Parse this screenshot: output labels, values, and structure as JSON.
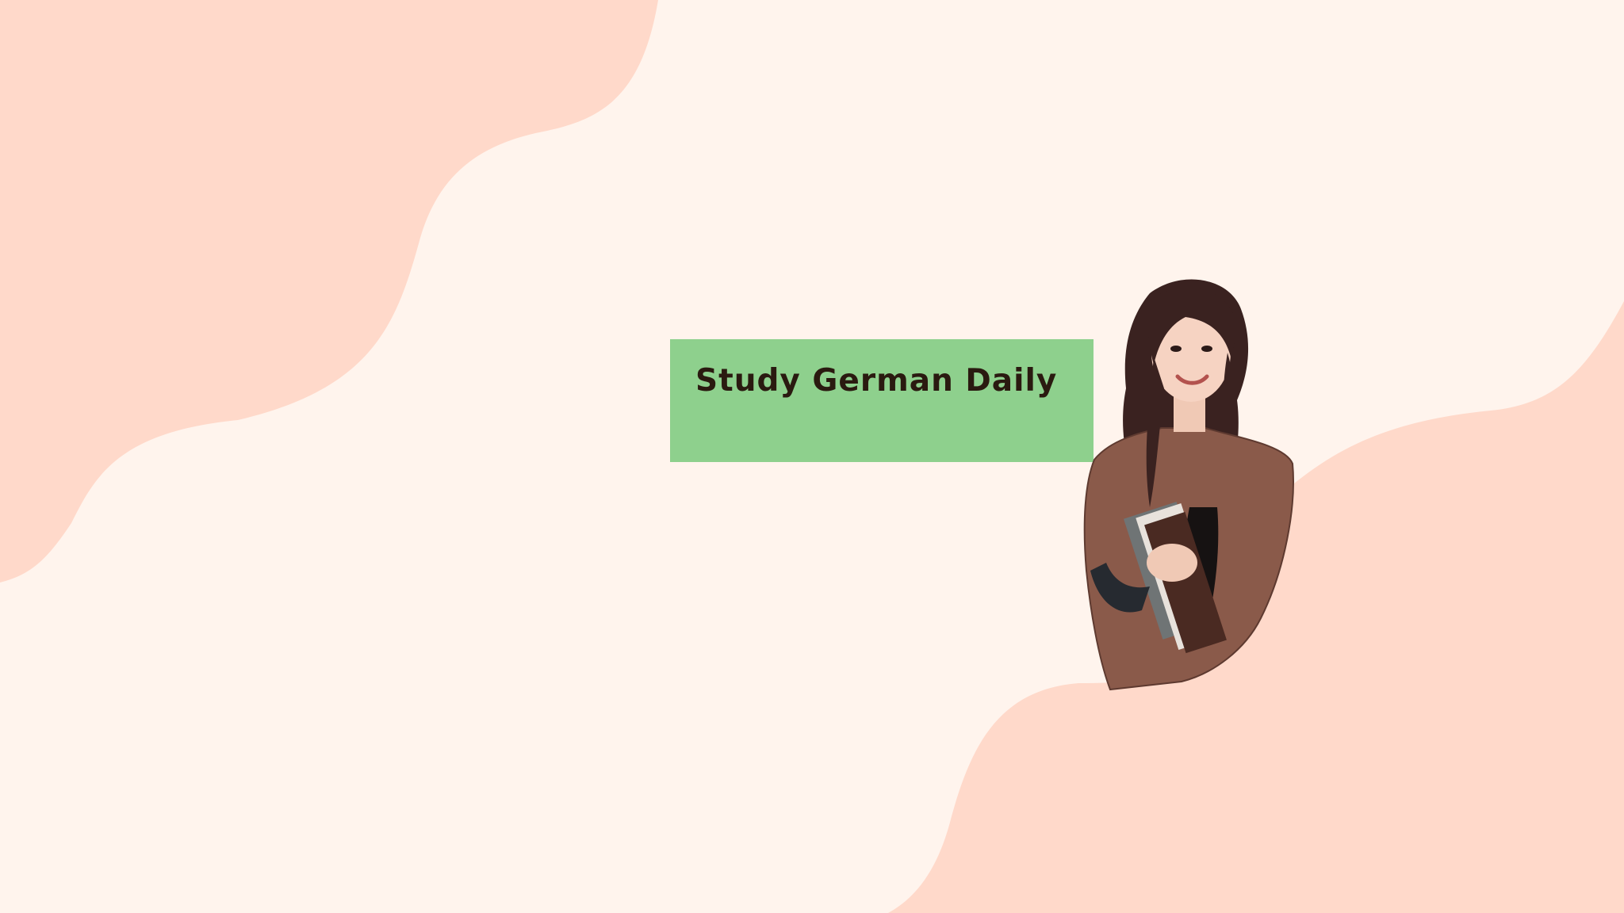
{
  "banner": {
    "title": "Study German Daily",
    "colors": {
      "background": "#fff4ed",
      "blob": "#ffd9ca",
      "title_box": "#8ed08d",
      "title_text": "#2a1a10"
    }
  },
  "person": {
    "icon": "woman-holding-books-photo"
  }
}
